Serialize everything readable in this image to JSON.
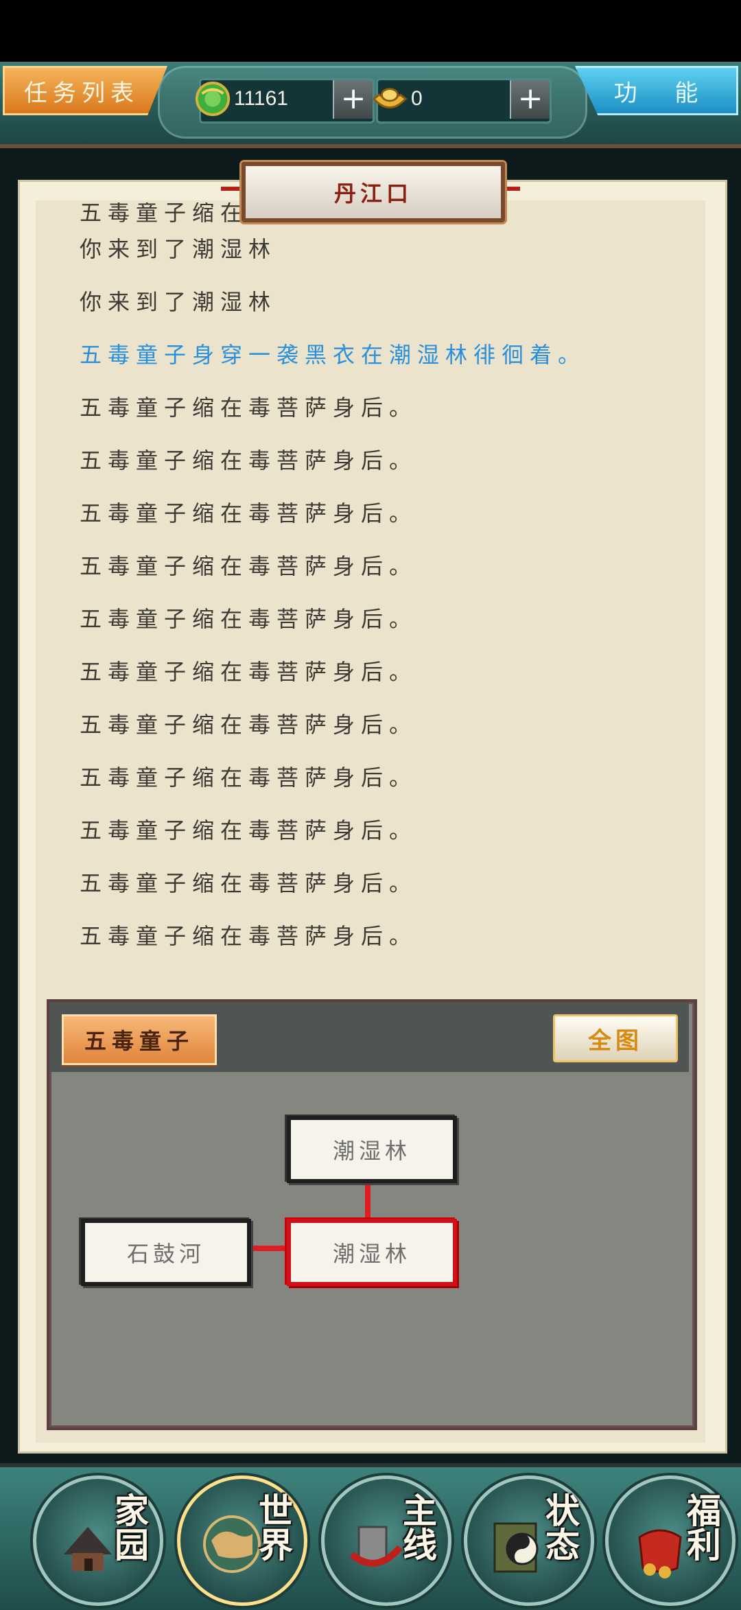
{
  "top_bar": {
    "task_list_label": "任务列表",
    "function_label": "功 能",
    "jade_amount": "11161",
    "gold_amount": "0",
    "plus_symbol": "+"
  },
  "scene": {
    "location_title": "丹江口",
    "messages": [
      {
        "text": "五毒童子缩在毒菩萨身后。",
        "highlight": false
      },
      {
        "text": "你来到了潮湿林",
        "highlight": false
      },
      {
        "text": "你来到了潮湿林",
        "highlight": false
      },
      {
        "text": "五毒童子身穿一袭黑衣在潮湿林徘徊着。",
        "highlight": true
      },
      {
        "text": "五毒童子缩在毒菩萨身后。",
        "highlight": false
      },
      {
        "text": "五毒童子缩在毒菩萨身后。",
        "highlight": false
      },
      {
        "text": "五毒童子缩在毒菩萨身后。",
        "highlight": false
      },
      {
        "text": "五毒童子缩在毒菩萨身后。",
        "highlight": false
      },
      {
        "text": "五毒童子缩在毒菩萨身后。",
        "highlight": false
      },
      {
        "text": "五毒童子缩在毒菩萨身后。",
        "highlight": false
      },
      {
        "text": "五毒童子缩在毒菩萨身后。",
        "highlight": false
      },
      {
        "text": "五毒童子缩在毒菩萨身后。",
        "highlight": false
      },
      {
        "text": "五毒童子缩在毒菩萨身后。",
        "highlight": false
      },
      {
        "text": "五毒童子缩在毒菩萨身后。",
        "highlight": false
      },
      {
        "text": "五毒童子缩在毒菩萨身后。",
        "highlight": false
      }
    ]
  },
  "map": {
    "npc_name": "五毒童子",
    "full_map_label": "全图",
    "nodes": {
      "north": "潮湿林",
      "current": "潮湿林",
      "west": "石鼓河"
    }
  },
  "nav": {
    "home": "家园",
    "world": "世界",
    "mainline": "主线",
    "status": "状态",
    "welfare": "福利"
  },
  "colors": {
    "highlight_text": "#2a90dc",
    "current_node_border": "#d0101a",
    "task_button": "#e8922e",
    "function_button": "#2fa8da"
  }
}
